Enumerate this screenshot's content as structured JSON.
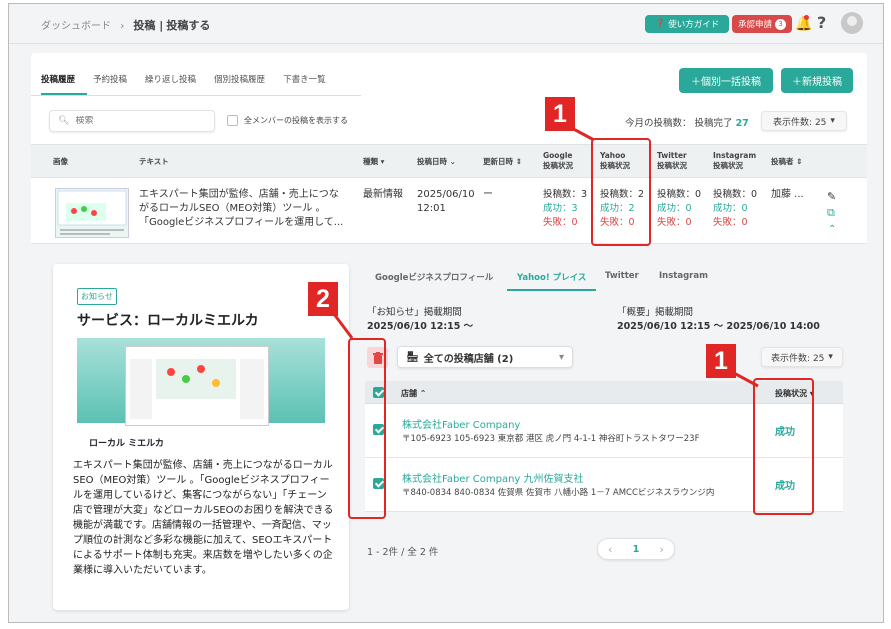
{
  "header": {
    "breadcrumb": [
      "ダッシュボード",
      "›",
      "投稿 |",
      "投稿する"
    ],
    "guide_label": "使い方ガイド",
    "approve_label": "承認申請",
    "approve_count": "3",
    "help_label": "?"
  },
  "tabs": [
    "投稿履歴",
    "予約投稿",
    "繰り返し投稿",
    "個別投稿履歴",
    "下書き一覧"
  ],
  "buttons": {
    "bulk_post": "＋個別一括投稿",
    "new_post": "＋新規投稿"
  },
  "search": {
    "placeholder": "検索"
  },
  "all_members_label": "全メンバーの投稿を表示する",
  "month_count": {
    "label": "今月の投稿数： 投稿完了",
    "value": "27"
  },
  "per_page": "表示件数: 25",
  "table": {
    "columns": {
      "image": "画像",
      "text": "テキスト",
      "type": "種類",
      "post_date": "投稿日時",
      "updated": "更新日時",
      "google": [
        "Google",
        "投稿状況"
      ],
      "yahoo": [
        "Yahoo",
        "投稿状況"
      ],
      "twitter": [
        "Twitter",
        "投稿状況"
      ],
      "instagram": [
        "Instagram",
        "投稿状況"
      ],
      "poster": "投稿者"
    },
    "row": {
      "text_lines": [
        "エキスパート集団が監修、店舗・売上につな",
        "がるローカルSEO（MEO対策）ツール 。",
        "「Googleビジネスプロフィールを運用して..."
      ],
      "type": "最新情報",
      "date_line1": "2025/06/10",
      "date_line2": "12:01",
      "updated": "ー",
      "google": {
        "count": "投稿数：3",
        "success": "成功：3",
        "fail": "失敗：0"
      },
      "yahoo": {
        "count": "投稿数：2",
        "success": "成功：2",
        "fail": "失敗：0"
      },
      "twitter": {
        "count": "投稿数：0",
        "success": "成功：0",
        "fail": "失敗：0"
      },
      "instagram": {
        "count": "投稿数：0",
        "success": "成功：0",
        "fail": "失敗：0"
      },
      "poster": "加藤 ..."
    }
  },
  "preview": {
    "badge": "お知らせ",
    "title": "サービス：ローカルミエルカ",
    "logo": "ローカル ミエルカ",
    "body": "エキスパート集団が監修、店舗・売上につながるローカルSEO（MEO対策）ツール 。「Googleビジネスプロフィールを運用しているけど、集客につながらない」「チェーン店で管理が大変」などローカルSEOのお困りを解決できる機能が満載です。店舗情報の一括管理や、一斉配信、マップ順位の計測など多彩な機能に加えて、SEOエキスパートによるサポート体制も充実。来店数を増やしたい多くの企業様に導入いただいています。"
  },
  "platform_tabs": [
    "Googleビジネスプロフィール",
    "Yahoo! プレイス",
    "Twitter",
    "Instagram"
  ],
  "periods": {
    "notice_label": "「お知らせ」掲載期間",
    "notice_value": "2025/06/10 12:15 〜",
    "summary_label": "「概要」掲載期間",
    "summary_value": "2025/06/10 12:15 〜 2025/06/10 14:00"
  },
  "store_select": "全ての投稿店舗 (2)",
  "store_per_page": "表示件数: 25",
  "store_table": {
    "col_store": "店舗",
    "col_status": "投稿状況",
    "rows": [
      {
        "name": "株式会社Faber Company",
        "address": "〒105-6923 105-6923 東京都 港区 虎ノ門 4-1-1 神谷町トラストタワー23F",
        "status": "成功"
      },
      {
        "name": "株式会社Faber Company 九州佐賀支社",
        "address": "〒840-0834 840-0834 佐賀県 佐賀市 八幡小路 1－7 AMCCビジネスラウンジ内",
        "status": "成功"
      }
    ]
  },
  "paging": {
    "summary": "1 - 2件 / 全 2 件",
    "page": "1",
    "prev": "‹",
    "next": "›"
  },
  "markers": [
    "1",
    "2",
    "1"
  ],
  "colors": {
    "accent": "#2aa99b",
    "danger": "#e04848",
    "marker": "#e12626"
  }
}
